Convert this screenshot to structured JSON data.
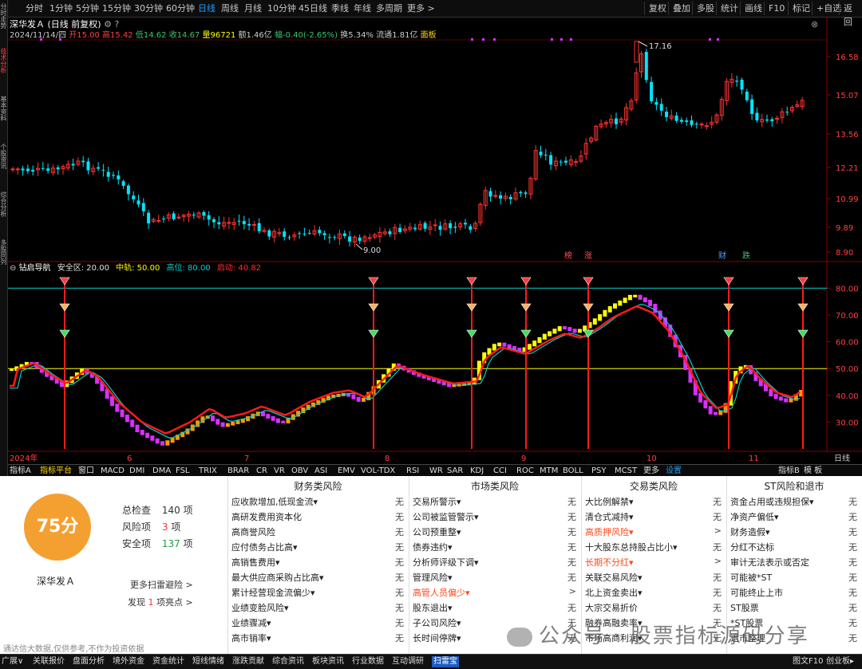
{
  "left_strip": [
    "分时走势",
    "技术分析",
    "基本资料",
    "个股资讯",
    "综合分析",
    "多股同列"
  ],
  "toolbar": {
    "periods": [
      "分时",
      "1分钟",
      "5分钟",
      "15分钟",
      "30分钟",
      "60分钟",
      "日线",
      "周线",
      "月线",
      "10分钟",
      "45日线",
      "季线",
      "年线",
      "多周期",
      "更多 >"
    ],
    "active_period": "日线",
    "right_buttons": [
      "复权",
      "叠加",
      "多股",
      "统计",
      "画线",
      "F10",
      "标记",
      "+自选",
      "返回"
    ]
  },
  "title": {
    "name": "深华发Ａ",
    "mode": "(日线 前复权)",
    "date": "2024/11/14/四",
    "open_label": "开",
    "open": "15.00",
    "high_label": "高",
    "high": "15.42",
    "low_label": "低",
    "low": "14.62",
    "close_label": "收",
    "close": "14.67",
    "vol_label": "量",
    "vol": "96721",
    "amt_label": "额",
    "amt": "1.46亿",
    "chg_label": "幅",
    "chg": "-0.40(-2.65%)",
    "turn_label": "换",
    "turn": "5.34%",
    "float_label": "流通",
    "float": "1.81亿",
    "panel_link": "面板"
  },
  "price_axis": [
    "16.58",
    "15.07",
    "13.56",
    "12.21",
    "10.99",
    "9.89",
    "8.90"
  ],
  "price_annot": {
    "high": "17.16",
    "low": "9.00"
  },
  "event_markers": [
    {
      "text": "榜",
      "color": "#ff5050"
    },
    {
      "text": "涨",
      "color": "#ff5050"
    },
    {
      "text": "财",
      "color": "#4aa3ff"
    },
    {
      "text": "跌",
      "color": "#3cc36c"
    }
  ],
  "indicator": {
    "name": "钻启导航",
    "lines": [
      {
        "label": "安全区: 20.00",
        "color": "#e0e0e0"
      },
      {
        "label": "中轨: 50.00",
        "color": "#ffff00"
      },
      {
        "label": "高位: 80.00",
        "color": "#00d0d0"
      },
      {
        "label": "启动: 40.82",
        "color": "#ff3030"
      }
    ],
    "axis": [
      "80.00",
      "70.00",
      "60.00",
      "50.00",
      "40.00",
      "30.00"
    ]
  },
  "date_axis": [
    "2024年",
    "6",
    "7",
    "8",
    "9",
    "10",
    "11"
  ],
  "date_axis_right": "日线",
  "tabs": [
    "指标A",
    "指标平台",
    "窗口",
    "MACD",
    "DMI",
    "DMA",
    "FSL",
    "TRIX",
    "BRAR",
    "CR",
    "VR",
    "OBV",
    "ASI",
    "EMV",
    "VOL-TDX",
    "RSI",
    "WR",
    "SAR",
    "KDJ",
    "CCI",
    "ROC",
    "MTM",
    "BOLL",
    "PSY",
    "MCST",
    "更多",
    "设置"
  ],
  "tabs_right": [
    "指标B",
    "模 板"
  ],
  "scan": {
    "score": "75分",
    "total_label": "总检查",
    "total": "140",
    "total_unit": "项",
    "risk_label": "风险项",
    "risk": "3",
    "risk_unit": "项",
    "safe_label": "安全项",
    "safe": "137",
    "safe_unit": "项",
    "stock": "深华发Ａ",
    "more": "更多扫雷避险 >",
    "found_pre": "发现",
    "found_num": "1",
    "found_post": "项亮点 >",
    "disclaimer": "通达信大数据,仅供参考,不作为投资依据",
    "columns": [
      {
        "title": "财务类风险",
        "items": [
          {
            "label": "应收款增加,低现金流▾",
            "value": "无"
          },
          {
            "label": "高研发费用资本化",
            "value": "无"
          },
          {
            "label": "高商誉风险",
            "value": "无"
          },
          {
            "label": "应付债务占比高▾",
            "value": "无"
          },
          {
            "label": "高销售费用▾",
            "value": "无"
          },
          {
            "label": "最大供应商采购占比高▾",
            "value": "无"
          },
          {
            "label": "累计经营现金流偏少▾",
            "value": "无"
          },
          {
            "label": "业绩变脸风险▾",
            "value": "无"
          },
          {
            "label": "业绩骤减▾",
            "value": "无"
          },
          {
            "label": "高市销率▾",
            "value": "无"
          }
        ]
      },
      {
        "title": "市场类风险",
        "items": [
          {
            "label": "交易所警示▾",
            "value": "无"
          },
          {
            "label": "公司被监管警示▾",
            "value": "无"
          },
          {
            "label": "公司预重整▾",
            "value": "无"
          },
          {
            "label": "债券违约▾",
            "value": "无"
          },
          {
            "label": "分析师评级下调▾",
            "value": "无"
          },
          {
            "label": "管理风险▾",
            "value": "无"
          },
          {
            "label": "高管人员偏少▾",
            "value": ">",
            "hl": true
          },
          {
            "label": "股东退出▾",
            "value": "无"
          },
          {
            "label": "子公司风险▾",
            "value": "无"
          },
          {
            "label": "长时间停牌▾",
            "value": "无"
          }
        ]
      },
      {
        "title": "交易类风险",
        "items": [
          {
            "label": "大比例解禁▾",
            "value": "无"
          },
          {
            "label": "清仓式减持▾",
            "value": "无"
          },
          {
            "label": "高质押风险▾",
            "value": ">",
            "hl": true
          },
          {
            "label": "十大股东总持股占比小▾",
            "value": "无"
          },
          {
            "label": "长期不分红▾",
            "value": ">",
            "hl": true
          },
          {
            "label": "关联交易风险▾",
            "value": "无"
          },
          {
            "label": "北上资金卖出▾",
            "value": "无"
          },
          {
            "label": "大宗交易折价",
            "value": "无"
          },
          {
            "label": "融券高融卖率▾",
            "value": "无"
          },
          {
            "label": "市场高商利润▾",
            "value": "无"
          }
        ]
      },
      {
        "title": "ST风险和退市",
        "items": [
          {
            "label": "资金占用或违规担保▾",
            "value": "无"
          },
          {
            "label": "净资产偏低▾",
            "value": "无"
          },
          {
            "label": "财务造假▾",
            "value": "无"
          },
          {
            "label": "分红不达标",
            "value": "无"
          },
          {
            "label": "审计无法表示或否定",
            "value": "无"
          },
          {
            "label": "可能被*ST",
            "value": "无"
          },
          {
            "label": "可能终止上市",
            "value": "无"
          },
          {
            "label": "ST股票",
            "value": "无"
          },
          {
            "label": "*ST股票",
            "value": "无"
          },
          {
            "label": "退市整理",
            "value": "无"
          }
        ]
      }
    ]
  },
  "watermark": "公众号 · 股票指标源码分享",
  "statusbar": [
    "广展∨",
    "关联报价",
    "盘面分析",
    "境外资金",
    "资金统计",
    "短线情绪",
    "涨跌贡献",
    "综合资讯",
    "板块资讯",
    "行业数据",
    "互动调研",
    "扫雷宝"
  ],
  "statusbar_active": "扫雷宝",
  "statusbar_right": [
    "图文F10",
    "创业板▸"
  ],
  "colors": {
    "up": "#ff3232",
    "down": "#00e5ff",
    "purple": "#d830ff",
    "yellow": "#ffff00",
    "orange": "#ff9900",
    "red_line": "#ff1a1a"
  }
}
